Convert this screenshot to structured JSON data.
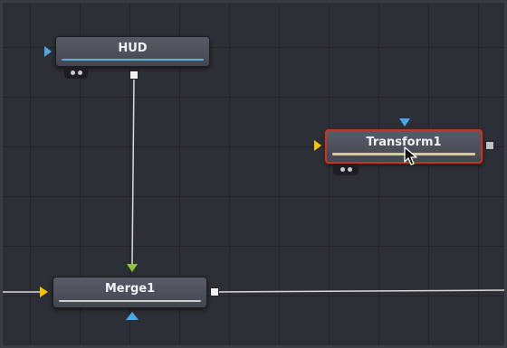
{
  "nodes": {
    "hud": {
      "label": "HUD"
    },
    "transform": {
      "label": "Transform1"
    },
    "merge": {
      "label": "Merge1"
    }
  },
  "colors": {
    "background_input": "#f5c400",
    "foreground_input": "#8cc43c",
    "mask_input": "#4aa8e8",
    "selection": "#c2352b",
    "hud_bar": "#5ab0d8",
    "transform_bar": "#d8cba0",
    "merge_bar": "#cfcfcf"
  },
  "icons": [
    "input-triangle-icon",
    "output-square-icon",
    "view-dots-icon",
    "mouse-pointer-icon"
  ]
}
